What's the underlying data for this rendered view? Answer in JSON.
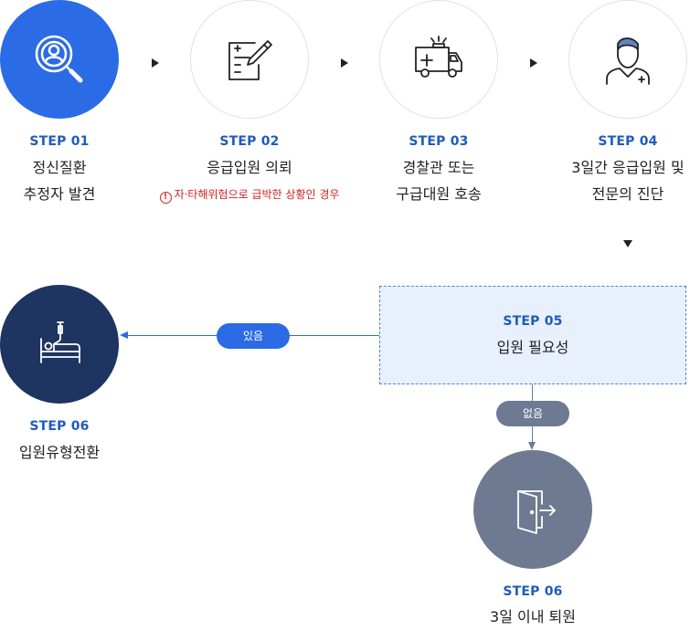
{
  "steps": [
    {
      "label": "STEP 01",
      "title_line1": "정신질환",
      "title_line2": "추정자 발견",
      "icon": "search-person-icon"
    },
    {
      "label": "STEP 02",
      "title_line1": "응급입원 의뢰",
      "warning": "자·타해위험으로 급박한 상황인 경우",
      "icon": "document-pen-icon"
    },
    {
      "label": "STEP 03",
      "title_line1": "경찰관 또는",
      "title_line2": "구급대원 호송",
      "icon": "ambulance-icon"
    },
    {
      "label": "STEP 04",
      "title_line1": "3일간 응급입원 및",
      "title_line2": "전문의 진단",
      "icon": "doctor-icon"
    },
    {
      "label": "STEP 05",
      "title_line1": "입원 필요성"
    },
    {
      "label": "STEP 06",
      "title_line1": "입원유형전환",
      "icon": "hospital-bed-icon"
    },
    {
      "label": "STEP 06",
      "title_line1": "3일 이내 퇴원",
      "icon": "exit-door-icon"
    }
  ],
  "branches": {
    "yes": "있음",
    "no": "없음"
  },
  "warning_symbol": "!",
  "colors": {
    "accent_blue": "#2b6be6",
    "navy": "#1e3461",
    "slate": "#6d7a91",
    "label_blue": "#1f5bbf",
    "warning_red": "#d32020",
    "decision_bg": "#e8f0fb"
  }
}
